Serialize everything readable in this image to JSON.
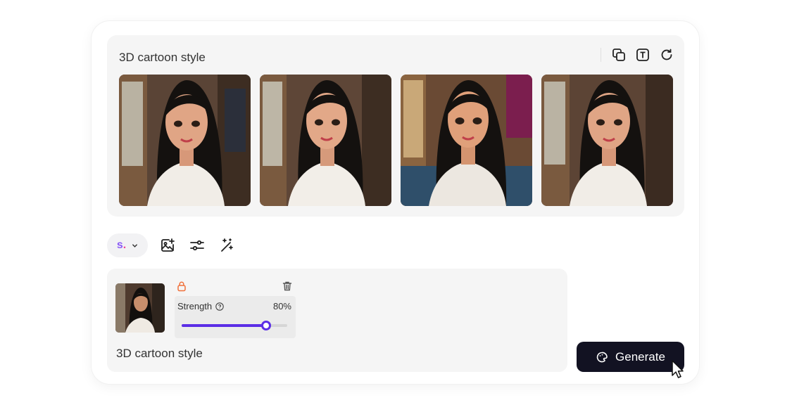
{
  "results": {
    "title": "3D cartoon style",
    "tools": [
      {
        "name": "copy-icon"
      },
      {
        "name": "text-icon"
      },
      {
        "name": "refresh-icon"
      }
    ],
    "images": [
      {
        "name": "generated-image-1",
        "icon": "cartoon-portrait"
      },
      {
        "name": "generated-image-2",
        "icon": "cartoon-portrait"
      },
      {
        "name": "generated-image-3",
        "icon": "cartoon-portrait"
      },
      {
        "name": "generated-image-4",
        "icon": "cartoon-portrait"
      }
    ]
  },
  "toolbar": {
    "model_logo": "s",
    "model_logo_dot": ".",
    "icons": [
      "image-add-icon",
      "sliders-icon",
      "magic-wand-icon"
    ]
  },
  "reference": {
    "strength_label": "Strength",
    "strength_value": "80%",
    "strength_fraction": 0.8
  },
  "prompt": {
    "text": "3D cartoon style"
  },
  "generate": {
    "label": "Generate"
  },
  "colors": {
    "accent": "#5b2ee6",
    "generate_bg": "#121222",
    "lock": "#f0703a",
    "logo": "#8b5cf6"
  }
}
